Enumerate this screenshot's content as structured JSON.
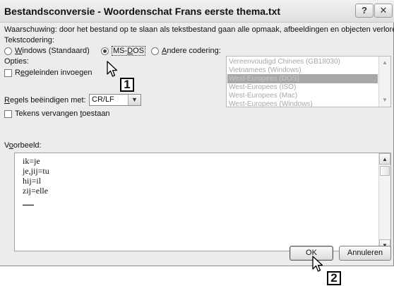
{
  "dialog": {
    "title": "Bestandsconversie - Woordenschat Frans eerste thema.txt",
    "help_glyph": "?",
    "close_glyph": "✕"
  },
  "warning": "Waarschuwing: door het bestand op te slaan als tekstbestand gaan alle opmaak, afbeeldingen en objecten verloren.",
  "encoding": {
    "label": "Tekstcodering:",
    "windows": {
      "pre": "",
      "accel": "W",
      "post": "indows (Standaard)"
    },
    "msdos": {
      "pre": "MS-",
      "accel": "D",
      "post": "OS"
    },
    "other": {
      "pre": "",
      "accel": "A",
      "post": "ndere codering:"
    },
    "selected": "MS-DOS",
    "list": [
      "Vereenvoudigd Chinees (GB18030)",
      "Vietnamees (Windows)",
      "West-Europees (DOS)",
      "West-Europees (ISO)",
      "West-Europees (Mac)",
      "West-Europees (Windows)"
    ],
    "list_selected_index": 2
  },
  "options": {
    "label": "Opties:",
    "insert_breaks": {
      "pre": "R",
      "accel": "e",
      "post": "geleinden invoegen",
      "checked": false
    },
    "end_lines": {
      "pre": "",
      "accel": "R",
      "post": "egels beëindigen met:"
    },
    "end_lines_value": "CR/LF",
    "substitute": {
      "pre": "Tekens vervangen ",
      "accel": "t",
      "post": "oestaan",
      "checked": false
    }
  },
  "preview": {
    "label": {
      "pre": "V",
      "accel": "o",
      "post": "orbeeld:"
    },
    "lines": [
      "ik=je",
      "je,jij=tu",
      "hij=il",
      "zij=elle",
      "—"
    ]
  },
  "buttons": {
    "ok": "OK",
    "cancel": "Annuleren"
  },
  "callouts": [
    "1",
    "2"
  ],
  "icons": {
    "scroll_up": "up-arrow-icon",
    "scroll_down": "down-arrow-icon",
    "dropdown": "chevron-down-icon",
    "cursor": "mouse-pointer-icon"
  }
}
